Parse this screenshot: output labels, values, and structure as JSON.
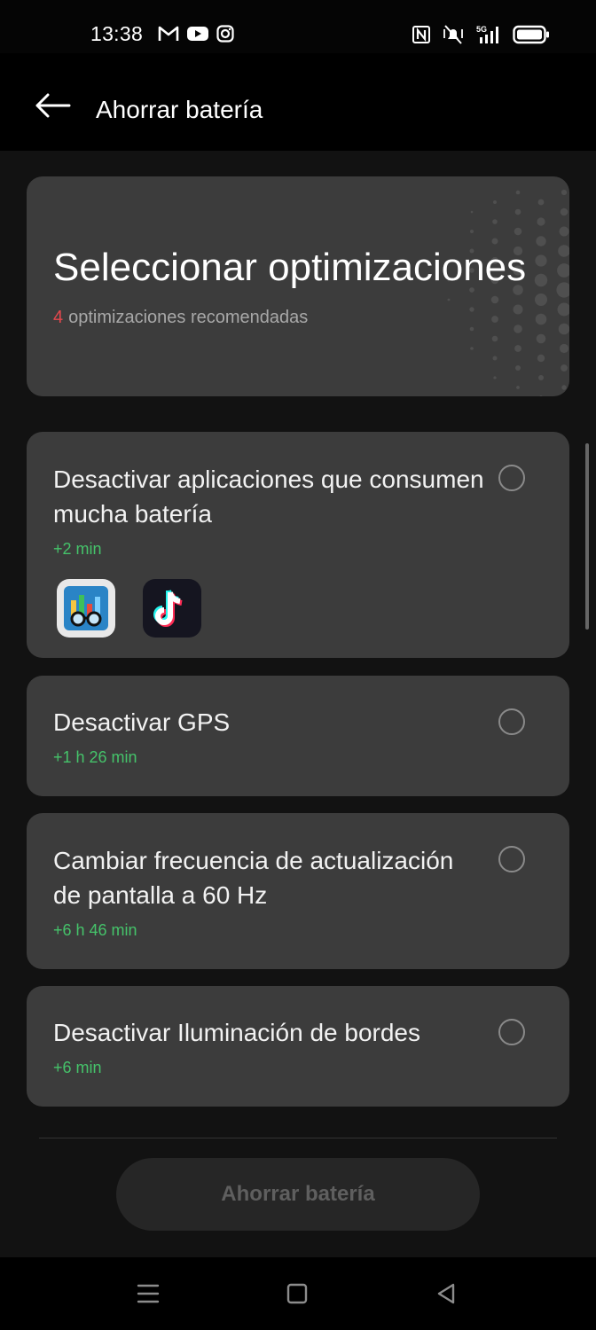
{
  "status_bar": {
    "time": "13:38",
    "left_icons": [
      "gmail-icon",
      "youtube-icon",
      "instagram-icon"
    ],
    "right_icons": [
      "nfc-icon",
      "vibrate-icon",
      "signal-5g-icon",
      "battery-icon"
    ],
    "network": "5G"
  },
  "app_bar": {
    "title": "Ahorrar batería"
  },
  "header": {
    "title": "Seleccionar optimizaciones",
    "count": "4",
    "subtitle": "optimizaciones recomendadas"
  },
  "optimizations": [
    {
      "title": "Desactivar aplicaciones que consumen mucha batería",
      "gain": "+2 min",
      "selected": false,
      "apps": [
        "geekbench-app-icon",
        "tiktok-app-icon"
      ]
    },
    {
      "title": "Desactivar GPS",
      "gain": "+1 h 26 min",
      "selected": false
    },
    {
      "title": "Cambiar frecuencia de actualización de pantalla a 60 Hz",
      "gain": "+6 h 46 min",
      "selected": false
    },
    {
      "title": "Desactivar Iluminación de bordes",
      "gain": "+6 min",
      "selected": false
    }
  ],
  "footer": {
    "save_label": "Ahorrar batería"
  },
  "colors": {
    "background": "#121212",
    "card": "#3c3c3c",
    "gain_green": "#45c36a",
    "count_red": "#e5484d"
  }
}
